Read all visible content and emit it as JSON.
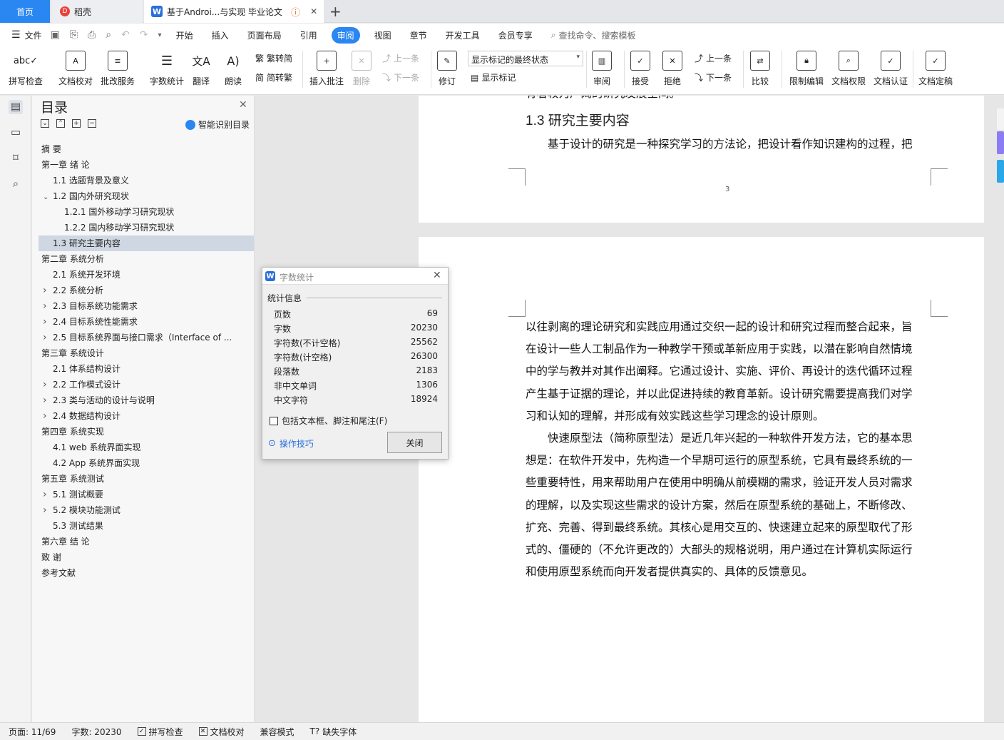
{
  "tabs": {
    "home": "首页",
    "daoke": "稻壳",
    "doc": "基于Androi...与实现 毕业论文",
    "new_tab": "+"
  },
  "menu": {
    "file": "文件",
    "items": [
      "开始",
      "插入",
      "页面布局",
      "引用",
      "审阅",
      "视图",
      "章节",
      "开发工具",
      "会员专享"
    ],
    "active": "审阅",
    "search_placeholder": "查找命令、搜索模板"
  },
  "ribbon": {
    "spell": "拼写检查",
    "proof": "文档校对",
    "review_service": "批改服务",
    "word_count": "字数统计",
    "translate": "翻译",
    "read": "朗读",
    "trad": "繁转简",
    "simp": "简转繁",
    "insert_comment": "插入批注",
    "delete": "删除",
    "prev": "上一条",
    "next": "下一条",
    "track": "修订",
    "markup_mode": "显示标记的最终状态",
    "show_markup": "显示标记",
    "review_pane": "审阅",
    "accept": "接受",
    "reject": "拒绝",
    "prev2": "上一条",
    "next2": "下一条",
    "compare": "比较",
    "restrict": "限制编辑",
    "permission": "文档权限",
    "cert": "文档认证",
    "finalize": "文档定稿"
  },
  "toc": {
    "title": "目录",
    "smart": "智能识别目录",
    "items": [
      {
        "label": "摘  要",
        "level": 0,
        "chev": ""
      },
      {
        "label": "第一章  绪  论",
        "level": 0,
        "chev": "v"
      },
      {
        "label": "1.1 选题背景及意义",
        "level": 1,
        "chev": ""
      },
      {
        "label": "1.2 国内外研究现状",
        "level": 1,
        "chev": "v"
      },
      {
        "label": "1.2.1 国外移动学习研究现状",
        "level": 2,
        "chev": ""
      },
      {
        "label": "1.2.2 国内移动学习研究现状",
        "level": 2,
        "chev": ""
      },
      {
        "label": "1.3 研究主要内容",
        "level": 1,
        "chev": "",
        "selected": true
      },
      {
        "label": "第二章  系统分析",
        "level": 0,
        "chev": "v"
      },
      {
        "label": "2.1 系统开发环境",
        "level": 1,
        "chev": ""
      },
      {
        "label": "2.2 系统分析",
        "level": 1,
        "chev": ">"
      },
      {
        "label": "2.3 目标系统功能需求",
        "level": 1,
        "chev": ">"
      },
      {
        "label": "2.4 目标系统性能需求",
        "level": 1,
        "chev": ">"
      },
      {
        "label": "2.5 目标系统界面与接口需求（Interface of ...",
        "level": 1,
        "chev": ">"
      },
      {
        "label": "第三章  系统设计",
        "level": 0,
        "chev": "v"
      },
      {
        "label": "2.1  体系结构设计",
        "level": 1,
        "chev": ""
      },
      {
        "label": "2.2  工作模式设计",
        "level": 1,
        "chev": ">"
      },
      {
        "label": "2.3 类与活动的设计与说明",
        "level": 1,
        "chev": ">"
      },
      {
        "label": "2.4 数据结构设计",
        "level": 1,
        "chev": ">"
      },
      {
        "label": "第四章  系统实现",
        "level": 0,
        "chev": "v"
      },
      {
        "label": "4.1 web 系统界面实现",
        "level": 1,
        "chev": ""
      },
      {
        "label": "4.2 App 系统界面实现",
        "level": 1,
        "chev": ""
      },
      {
        "label": "第五章  系统测试",
        "level": 0,
        "chev": "v"
      },
      {
        "label": "5.1 测试概要",
        "level": 1,
        "chev": ">"
      },
      {
        "label": "5.2 模块功能测试",
        "level": 1,
        "chev": ">"
      },
      {
        "label": "5.3  测试结果",
        "level": 1,
        "chev": ""
      },
      {
        "label": "第六章  结  论",
        "level": 0,
        "chev": ""
      },
      {
        "label": "致  谢",
        "level": 0,
        "chev": ""
      },
      {
        "label": "参考文献",
        "level": 0,
        "chev": ""
      }
    ]
  },
  "doc": {
    "cut_line": "有着较为广阔的研究发展空间。",
    "heading": "1.3 研究主要内容",
    "p1_first": "基于设计的研究是一种探究学习的方法论，把设计看作知识建构的过程，把",
    "page_number": "3",
    "page2_lines": [
      "以往剥离的理论研究和实践应用通过交织一起的设计和研究过程而整合起来，旨",
      "在设计一些人工制品作为一种教学干预或革新应用于实践，以潜在影响自然情境",
      "中的学与教并对其作出阐释。它通过设计、实施、评价、再设计的迭代循环过程",
      "产生基于证据的理论，并以此促进持续的教育革新。设计研究需要提高我们对学",
      "习和认知的理解，并形成有效实践这些学习理念的设计原则。",
      "快速原型法（简称原型法）是近几年兴起的一种软件开发方法，它的基本思",
      "想是：在软件开发中，先构造一个早期可运行的原型系统，它具有最终系统的一",
      "些重要特性，用来帮助用户在使用中明确从前模糊的需求，验证开发人员对需求",
      "的理解，以及实现这些需求的设计方案，然后在原型系统的基础上，不断修改、",
      "扩充、完善、得到最终系统。其核心是用交互的、快速建立起来的原型取代了形",
      "式的、僵硬的（不允许更改的）大部头的规格说明，用户通过在计算机实际运行",
      "和使用原型系统而向开发者提供真实的、具体的反馈意见。"
    ]
  },
  "dialog": {
    "title": "字数统计",
    "section": "统计信息",
    "rows": [
      {
        "k": "页数",
        "v": "69"
      },
      {
        "k": "字数",
        "v": "20230"
      },
      {
        "k": "字符数(不计空格)",
        "v": "25562"
      },
      {
        "k": "字符数(计空格)",
        "v": "26300"
      },
      {
        "k": "段落数",
        "v": "2183"
      },
      {
        "k": "非中文单词",
        "v": "1306"
      },
      {
        "k": "中文字符",
        "v": "18924"
      }
    ],
    "checkbox": "包括文本框、脚注和尾注(F)",
    "tips": "操作技巧",
    "close": "关闭"
  },
  "status": {
    "page": "页面: 11/69",
    "words": "字数: 20230",
    "spell": "拼写检查",
    "proof": "文档校对",
    "compat": "兼容模式",
    "missing_font": "缺失字体"
  },
  "colors": {
    "accent": "#2a86f0",
    "selected_toc": "#cfd7e2"
  }
}
